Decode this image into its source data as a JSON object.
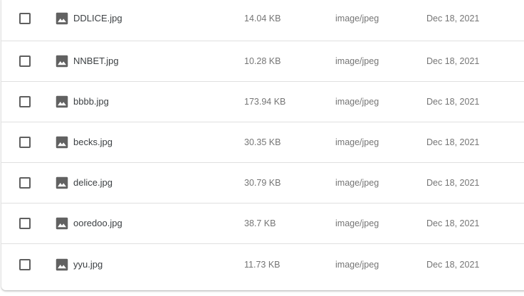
{
  "files": [
    {
      "name": "DDLICE.jpg",
      "size": "14.04 KB",
      "type": "image/jpeg",
      "date": "Dec 18, 2021"
    },
    {
      "name": "NNBET.jpg",
      "size": "10.28 KB",
      "type": "image/jpeg",
      "date": "Dec 18, 2021"
    },
    {
      "name": "bbbb.jpg",
      "size": "173.94 KB",
      "type": "image/jpeg",
      "date": "Dec 18, 2021"
    },
    {
      "name": "becks.jpg",
      "size": "30.35 KB",
      "type": "image/jpeg",
      "date": "Dec 18, 2021"
    },
    {
      "name": "delice.jpg",
      "size": "30.79 KB",
      "type": "image/jpeg",
      "date": "Dec 18, 2021"
    },
    {
      "name": "ooredoo.jpg",
      "size": "38.7 KB",
      "type": "image/jpeg",
      "date": "Dec 18, 2021"
    },
    {
      "name": "yyu.jpg",
      "size": "11.73 KB",
      "type": "image/jpeg",
      "date": "Dec 18, 2021"
    }
  ],
  "icons": {
    "checkbox": "checkbox-unchecked-icon",
    "file": "image-file-icon"
  },
  "colors": {
    "text_primary": "#3c4043",
    "text_secondary": "#757575",
    "icon": "#616161",
    "divider": "#e0e0e0"
  }
}
